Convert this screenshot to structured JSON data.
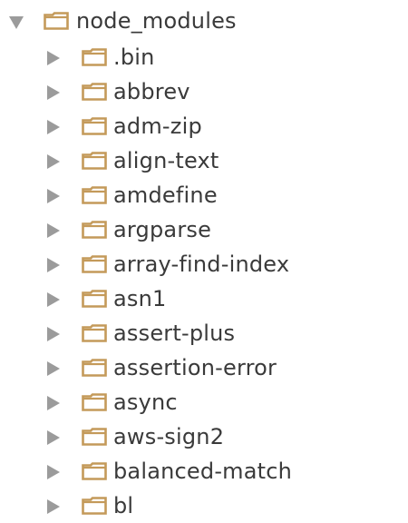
{
  "tree": {
    "root": {
      "label": "node_modules",
      "expanded": true,
      "icon": "folder-icon",
      "folder_color": "#c49a5a"
    },
    "children": [
      {
        "label": ".bin"
      },
      {
        "label": "abbrev"
      },
      {
        "label": "adm-zip"
      },
      {
        "label": "align-text"
      },
      {
        "label": "amdefine"
      },
      {
        "label": "argparse"
      },
      {
        "label": "array-find-index"
      },
      {
        "label": "asn1"
      },
      {
        "label": "assert-plus"
      },
      {
        "label": "assertion-error"
      },
      {
        "label": "async"
      },
      {
        "label": "aws-sign2"
      },
      {
        "label": "balanced-match"
      },
      {
        "label": "bl"
      }
    ]
  }
}
